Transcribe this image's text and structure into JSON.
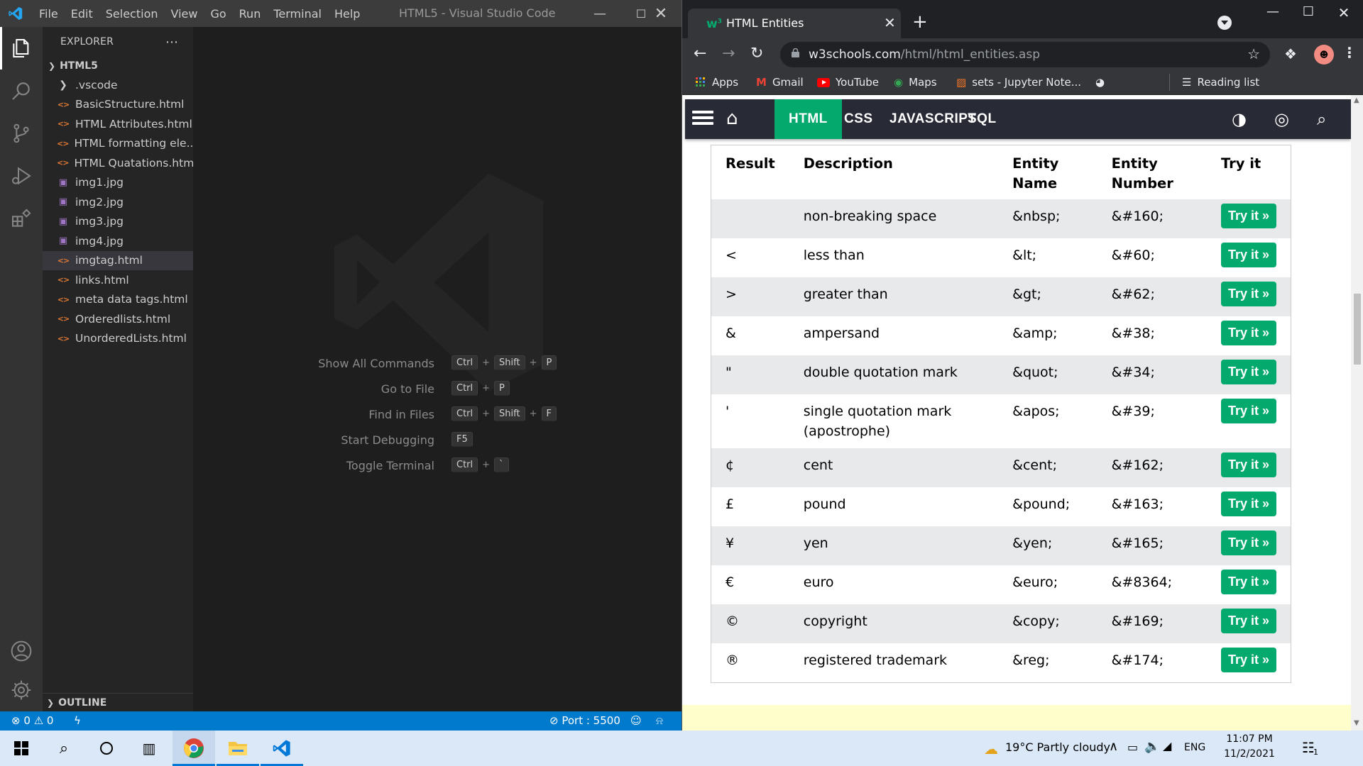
{
  "vscode": {
    "menu": [
      "File",
      "Edit",
      "Selection",
      "View",
      "Go",
      "Run",
      "Terminal",
      "Help"
    ],
    "title": "HTML5 - Visual Studio Code",
    "explorer_label": "EXPLORER",
    "folder_name": "HTML5",
    "files": [
      {
        "name": ".vscode",
        "type": "folder"
      },
      {
        "name": "BasicStructure.html",
        "type": "html"
      },
      {
        "name": "HTML Attributes.html",
        "type": "html"
      },
      {
        "name": "HTML formatting ele...",
        "type": "html"
      },
      {
        "name": "HTML Quatations.html",
        "type": "html"
      },
      {
        "name": "img1.jpg",
        "type": "image"
      },
      {
        "name": "img2.jpg",
        "type": "image"
      },
      {
        "name": "img3.jpg",
        "type": "image"
      },
      {
        "name": "img4.jpg",
        "type": "image"
      },
      {
        "name": "imgtag.html",
        "type": "html",
        "selected": true
      },
      {
        "name": "links.html",
        "type": "html"
      },
      {
        "name": "meta data tags.html",
        "type": "html"
      },
      {
        "name": "Orderedlists.html",
        "type": "html"
      },
      {
        "name": "UnorderedLists.html",
        "type": "html"
      }
    ],
    "outline_label": "OUTLINE",
    "shortcuts": [
      {
        "label": "Show All Commands",
        "keys": [
          "Ctrl",
          "Shift",
          "P"
        ]
      },
      {
        "label": "Go to File",
        "keys": [
          "Ctrl",
          "P"
        ]
      },
      {
        "label": "Find in Files",
        "keys": [
          "Ctrl",
          "Shift",
          "F"
        ]
      },
      {
        "label": "Start Debugging",
        "keys": [
          "F5"
        ]
      },
      {
        "label": "Toggle Terminal",
        "keys": [
          "Ctrl",
          "`"
        ]
      }
    ],
    "status": {
      "errors": "0",
      "warnings": "0",
      "port": "Port : 5500"
    },
    "colors": {
      "statusbar": "#007acc",
      "titlebar": "#3c3c3c",
      "sidebar": "#252526"
    }
  },
  "chrome": {
    "tab_title": "HTML Entities",
    "url_host": "w3schools.com",
    "url_path": "/html/html_entities.asp",
    "bookmarks": [
      "Apps",
      "Gmail",
      "YouTube",
      "Maps",
      "sets - Jupyter Note..."
    ],
    "reading_list": "Reading list"
  },
  "w3": {
    "nav": [
      "HTML",
      "CSS",
      "JAVASCRIPT",
      "SQL"
    ],
    "active_nav": "HTML",
    "accent": "#04aa6d",
    "table": {
      "headers": [
        "Result",
        "Description",
        "Entity Name",
        "Entity Number",
        "Try it"
      ],
      "try_label": "Try it »",
      "rows": [
        {
          "result": " ",
          "description": "non-breaking space",
          "name": "&nbsp;",
          "number": "&#160;"
        },
        {
          "result": "<",
          "description": "less than",
          "name": "&lt;",
          "number": "&#60;"
        },
        {
          "result": ">",
          "description": "greater than",
          "name": "&gt;",
          "number": "&#62;"
        },
        {
          "result": "&",
          "description": "ampersand",
          "name": "&amp;",
          "number": "&#38;"
        },
        {
          "result": "\"",
          "description": "double quotation mark",
          "name": "&quot;",
          "number": "&#34;"
        },
        {
          "result": "'",
          "description": "single quotation mark (apostrophe)",
          "name": "&apos;",
          "number": "&#39;"
        },
        {
          "result": "¢",
          "description": "cent",
          "name": "&cent;",
          "number": "&#162;"
        },
        {
          "result": "£",
          "description": "pound",
          "name": "&pound;",
          "number": "&#163;"
        },
        {
          "result": "¥",
          "description": "yen",
          "name": "&yen;",
          "number": "&#165;"
        },
        {
          "result": "€",
          "description": "euro",
          "name": "&euro;",
          "number": "&#8364;"
        },
        {
          "result": "©",
          "description": "copyright",
          "name": "&copy;",
          "number": "&#169;"
        },
        {
          "result": "®",
          "description": "registered trademark",
          "name": "&reg;",
          "number": "&#174;"
        }
      ]
    }
  },
  "taskbar": {
    "weather": "19°C  Partly cloudy",
    "lang": "ENG",
    "time": "11:07 PM",
    "date": "11/2/2021",
    "notification_count": "1"
  }
}
